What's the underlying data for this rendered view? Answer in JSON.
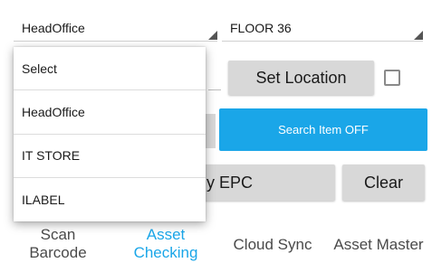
{
  "location_spinner": {
    "value": "HeadOffice"
  },
  "floor_spinner": {
    "value": "FLOOR 36"
  },
  "set_location_button": {
    "label": "Set Location"
  },
  "search_item_button": {
    "label": "Search Item OFF"
  },
  "by_epc_button": {
    "label": "y EPC"
  },
  "clear_button": {
    "label": "Clear"
  },
  "dropdown": {
    "items": [
      {
        "label": "Select"
      },
      {
        "label": "HeadOffice"
      },
      {
        "label": "IT STORE"
      },
      {
        "label": "ILABEL"
      }
    ]
  },
  "bottom_nav": {
    "scan_barcode": {
      "line1": "Scan",
      "line2": "Barcode"
    },
    "asset_checking": {
      "line1": "Asset",
      "line2": "Checking"
    },
    "cloud_sync": {
      "label": "Cloud Sync"
    },
    "asset_master": {
      "label": "Asset Master"
    }
  },
  "colors": {
    "accent": "#1aa6e8",
    "button_grey": "#d8d8d8"
  }
}
